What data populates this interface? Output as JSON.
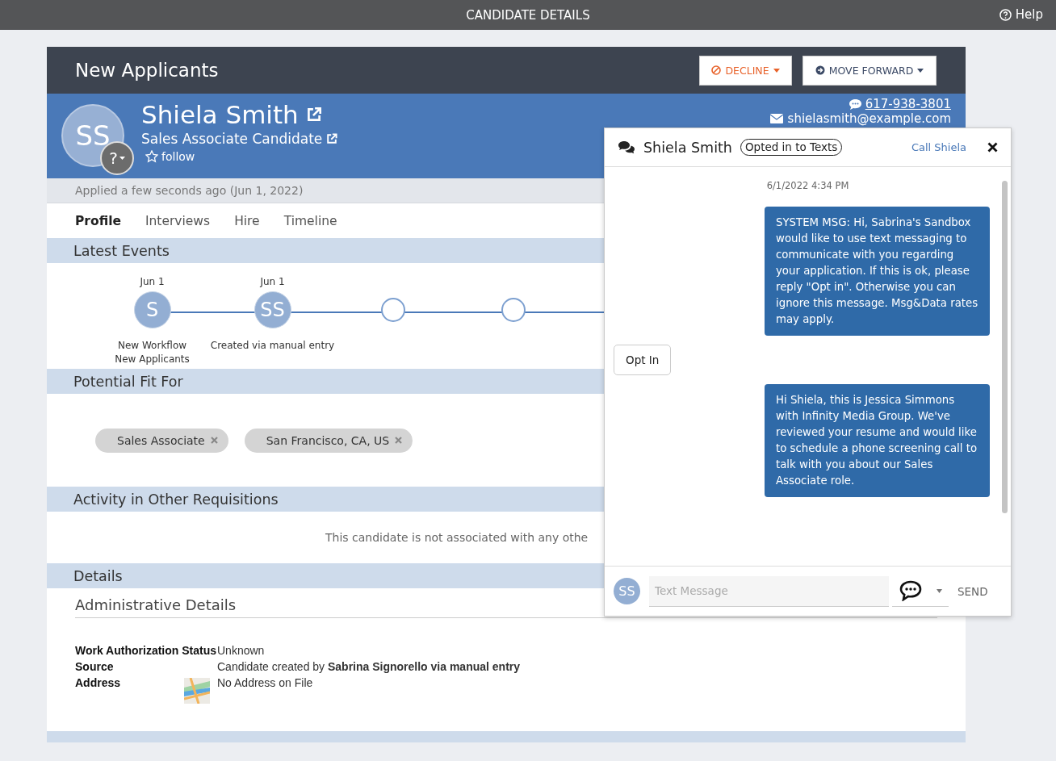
{
  "top_bar": {
    "title": "CANDIDATE DETAILS",
    "help": "Help"
  },
  "header": {
    "title": "New Applicants",
    "buttons": [
      {
        "label": "DECLINE",
        "kind": "decline"
      },
      {
        "label": "MOVE FORWARD",
        "kind": "forward"
      }
    ]
  },
  "candidate": {
    "initials": "SS",
    "status_badge": "?",
    "name": "Shiela Smith",
    "position": "Sales Associate Candidate",
    "follow": "follow",
    "phone": "617-938-3801",
    "email": "shielasmith@example.com",
    "applied": "Applied a few seconds ago (Jun 1, 2022)"
  },
  "tabs": [
    {
      "label": "Profile",
      "selected": true
    },
    {
      "label": "Interviews",
      "selected": false
    },
    {
      "label": "Hire",
      "selected": false
    },
    {
      "label": "Timeline",
      "selected": false
    }
  ],
  "latest_events": {
    "title": "Latest Events",
    "events": [
      {
        "kind": "event",
        "date": "Jun 1",
        "initials": "S",
        "lines": [
          "New Workflow",
          "New Applicants"
        ]
      },
      {
        "kind": "event",
        "date": "Jun 1",
        "initials": "SS",
        "lines": [
          "Created via manual entry"
        ]
      },
      {
        "kind": "empty"
      },
      {
        "kind": "empty"
      }
    ]
  },
  "potential_fit": {
    "title": "Potential Fit For",
    "tags": [
      "Sales Associate",
      "San Francisco, CA, US"
    ]
  },
  "activity": {
    "title": "Activity in Other Requisitions",
    "message": "This candidate is not associated with any othe"
  },
  "details": {
    "title": "Details",
    "subtitle": "Administrative Details",
    "rows": [
      {
        "kind": "text",
        "label": "Work Authorization Status",
        "value": "Unknown"
      },
      {
        "kind": "text",
        "label": "Source",
        "value": "Candidate created by **Sabrina Signorello via manual entry**"
      },
      {
        "kind": "map",
        "label": "Address",
        "value": "No Address on File"
      }
    ]
  },
  "chat": {
    "name": "Shiela Smith",
    "badge": "Opted in to Texts",
    "call": "Call Shiela",
    "timestamp": "6/1/2022 4:34 PM",
    "messages": [
      {
        "kind": "outgoing",
        "text": "SYSTEM MSG: Hi, Sabrina's Sandbox would like to use text messaging to communicate with you regarding your application. If this is ok, please reply \"Opt in\". Otherwise you can ignore this message. Msg&Data rates may apply."
      },
      {
        "kind": "incoming",
        "text": "Opt In"
      },
      {
        "kind": "outgoing",
        "text": "Hi Shiela, this is Jessica Simmons with Infinity Media Group. We've reviewed your resume and would like to schedule a phone screening call to talk with you about our Sales Associate role."
      }
    ],
    "composer": {
      "initials": "SS",
      "placeholder": "Text Message",
      "send": "SEND"
    }
  }
}
